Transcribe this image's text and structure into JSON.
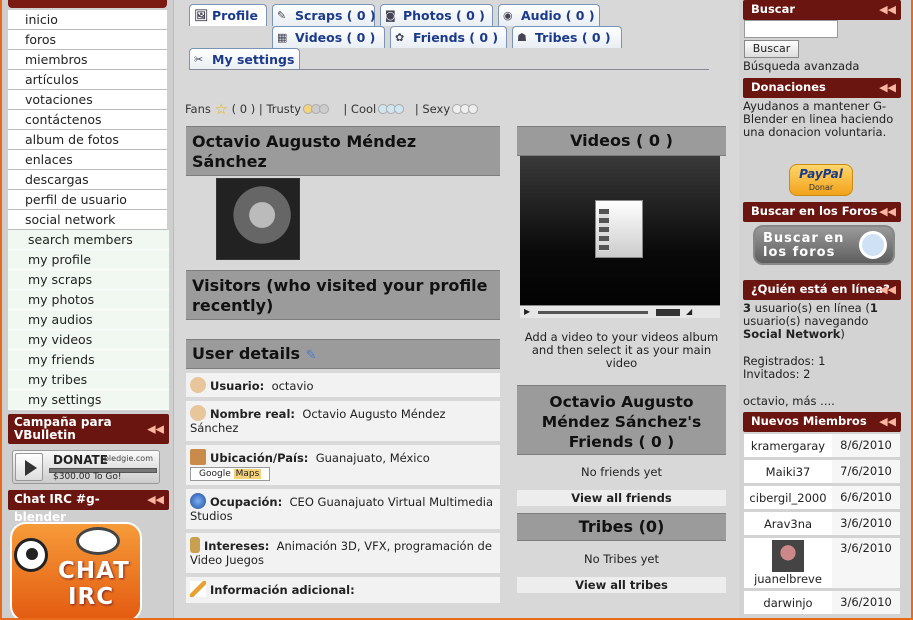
{
  "left": {
    "nav": [
      "inicio",
      "foros",
      "miembros",
      "artículos",
      "votaciones",
      "contáctenos",
      "album de fotos",
      "enlaces",
      "descargas",
      "perfil de usuario",
      "social network"
    ],
    "subnav": [
      "search members",
      "my profile",
      "my scraps",
      "my photos",
      "my audios",
      "my videos",
      "my friends",
      "my tribes",
      "my settings"
    ],
    "campaign_title": "Campaña para VBulletin",
    "donate": {
      "label": "DONATE",
      "site": "pledgie.com",
      "amount": "$300.00 To Go!",
      "progress_pct": 2
    },
    "chat_title": "Chat IRC #g-blender",
    "chat_logo": [
      "CHAT",
      "IRC"
    ]
  },
  "tabs": [
    {
      "label": "Profile",
      "icon": "profile-icon",
      "active": true
    },
    {
      "label": "Scraps ( 0 )",
      "icon": "scraps-icon"
    },
    {
      "label": "Photos ( 0 )",
      "icon": "camera-icon"
    },
    {
      "label": "Audio ( 0 )",
      "icon": "audio-icon"
    },
    {
      "label": "Videos ( 0 )",
      "icon": "video-icon"
    },
    {
      "label": "Friends ( 0 )",
      "icon": "friends-icon"
    },
    {
      "label": "Tribes ( 0 )",
      "icon": "tribes-icon"
    },
    {
      "label": "My settings",
      "icon": "settings-icon"
    }
  ],
  "ratings": {
    "fans_label": "Fans",
    "fans_count": "( 0 )",
    "trusty": "| Trusty",
    "cool": "| Cool",
    "sexy": "| Sexy"
  },
  "profile": {
    "name": "Octavio Augusto Méndez Sánchez",
    "visitors_title": "Visitors (who visited your profile recently)",
    "details_title": "User details",
    "fields": [
      {
        "label": "Usuario:",
        "value": "octavio"
      },
      {
        "label": "Nombre real:",
        "value": "Octavio Augusto Méndez Sánchez"
      },
      {
        "label": "Ubicación/País:",
        "value": "Guanajuato, México"
      },
      {
        "label": "Ocupación:",
        "value": "CEO Guanajuato Virtual Multimedia Studios"
      },
      {
        "label": "Intereses:",
        "value": "Animación 3D, VFX, programación de Video Juegos"
      },
      {
        "label": "Información adicional:",
        "value": ""
      }
    ],
    "google_maps": "Maps",
    "google": "Google"
  },
  "videos": {
    "title": "Videos ( 0 )",
    "hint": "Add a video to your videos album and then select it as your main video"
  },
  "friends": {
    "title": "Octavio Augusto Méndez Sánchez's Friends ( 0 )",
    "empty": "No friends yet",
    "view_all": "View all friends"
  },
  "tribes": {
    "title": "Tribes (0)",
    "empty": "No Tribes yet",
    "view_all": "View all tribes"
  },
  "right": {
    "buscar_title": "Buscar",
    "buscar_btn": "Buscar",
    "busqueda_avanzada": "Búsqueda avanzada",
    "donaciones_title": "Donaciones",
    "donaciones_text": "Ayudanos a mantener G-Blender en linea haciendo una donacion voluntaria.",
    "paypal": "PayPal",
    "paypal_sub": "Donar",
    "buscar_foros_title": "Buscar en los Foros",
    "buscar_foros_btn": "Buscar en los foros",
    "quien_title": "¿Quién está en línea?",
    "online_count": "3",
    "online_text": "usuario(s) en línea (",
    "online_nav_count": "1",
    "online_nav_text": "usuario(s) navegando",
    "online_where": "Social Network",
    "registrados": "Registrados: 1",
    "invitados": "Invitados: 2",
    "online_list": "octavio, más ....",
    "nuevos_title": "Nuevos Miembros",
    "members": [
      {
        "name": "kramergaray",
        "date": "8/6/2010"
      },
      {
        "name": "Maiki37",
        "date": "7/6/2010"
      },
      {
        "name": "cibergil_2000",
        "date": "6/6/2010"
      },
      {
        "name": "Arav3na",
        "date": "3/6/2010"
      },
      {
        "name": "juanelbreve",
        "date": "3/6/2010",
        "avatar": true
      },
      {
        "name": "darwinjo",
        "date": "3/6/2010"
      }
    ]
  }
}
